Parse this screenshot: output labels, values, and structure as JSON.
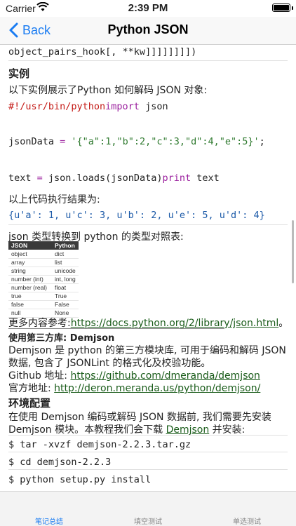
{
  "status": {
    "carrier": "Carrier",
    "time": "2:39 PM"
  },
  "nav": {
    "back_label": "Back",
    "title": "Python JSON"
  },
  "content": {
    "top_code_line": "object_pairs_hook[, **kw]]]]]]]])",
    "example_heading": "实例",
    "example_desc": "以下实例展示了Python 如何解码 JSON 对象:",
    "code1_shebang": "#!/usr/bin/python",
    "code1_import_kw": "import",
    "code1_import_mod": " json",
    "code2_var": "jsonData",
    "code2_eq": " = ",
    "code2_str": "'{\"a\":1,\"b\":2,\"c\":3,\"d\":4,\"e\":5}'",
    "code2_end": ";",
    "code3_text": "text",
    "code3_eq": " = ",
    "code3_call": "json.loads(jsonData)",
    "code3_print": "print",
    "code3_arg": " text",
    "result_label": "以上代码执行结果为:",
    "result_code": "{u'a': 1, u'c': 3, u'b': 2, u'e': 5, u'd': 4}",
    "types_desc": "json 类型转换到 python 的类型对照表:",
    "type_table": {
      "headers": [
        "JSON",
        "Python"
      ],
      "rows": [
        [
          "object",
          "dict"
        ],
        [
          "array",
          "list"
        ],
        [
          "string",
          "unicode"
        ],
        [
          "number (int)",
          "int, long"
        ],
        [
          "number (real)",
          "float"
        ],
        [
          "true",
          "True"
        ],
        [
          "false",
          "False"
        ],
        [
          "null",
          "None"
        ]
      ]
    },
    "more_ref_prefix": "更多内容参考:",
    "more_ref_link": "https://docs.python.org/2/library/json.html",
    "more_ref_suffix": "。",
    "third_party_heading": "使用第三方库: Demjson",
    "demjson_desc1": "Demjson 是 python 的第三方模块库, 可用于编码和解码 JSON",
    "demjson_desc2": "数据, 包含了 JSONLint 的格式化及校验功能。",
    "github_label": "Github 地址:",
    "github_link": "https://github.com/dmeranda/demjson",
    "official_label": "官方地址:",
    "official_link": "http://deron.meranda.us/python/demjson/",
    "env_heading": "环境配置",
    "env_desc1": "在使用 Demjson 编码或解码 JSON 数据前, 我们需要先安装",
    "env_desc2_pre": "Demjson 模块。本教程我们会下载 ",
    "env_desc2_link": "Demjson",
    "env_desc2_post": " 并安装:",
    "cmd1": "$ tar -xvzf demjson-2.2.3.tar.gz",
    "cmd2": "$ cd demjson-2.2.3",
    "cmd3": "$ python setup.py install"
  },
  "tabs": [
    {
      "label": "笔记总结",
      "active": true
    },
    {
      "label": "填空测试",
      "active": false
    },
    {
      "label": "单选测试",
      "active": false
    }
  ],
  "colors": {
    "accent": "#1a7cf2",
    "link": "#1a5c1a",
    "keyword": "#c41a16",
    "string": "#2f7a2f"
  }
}
